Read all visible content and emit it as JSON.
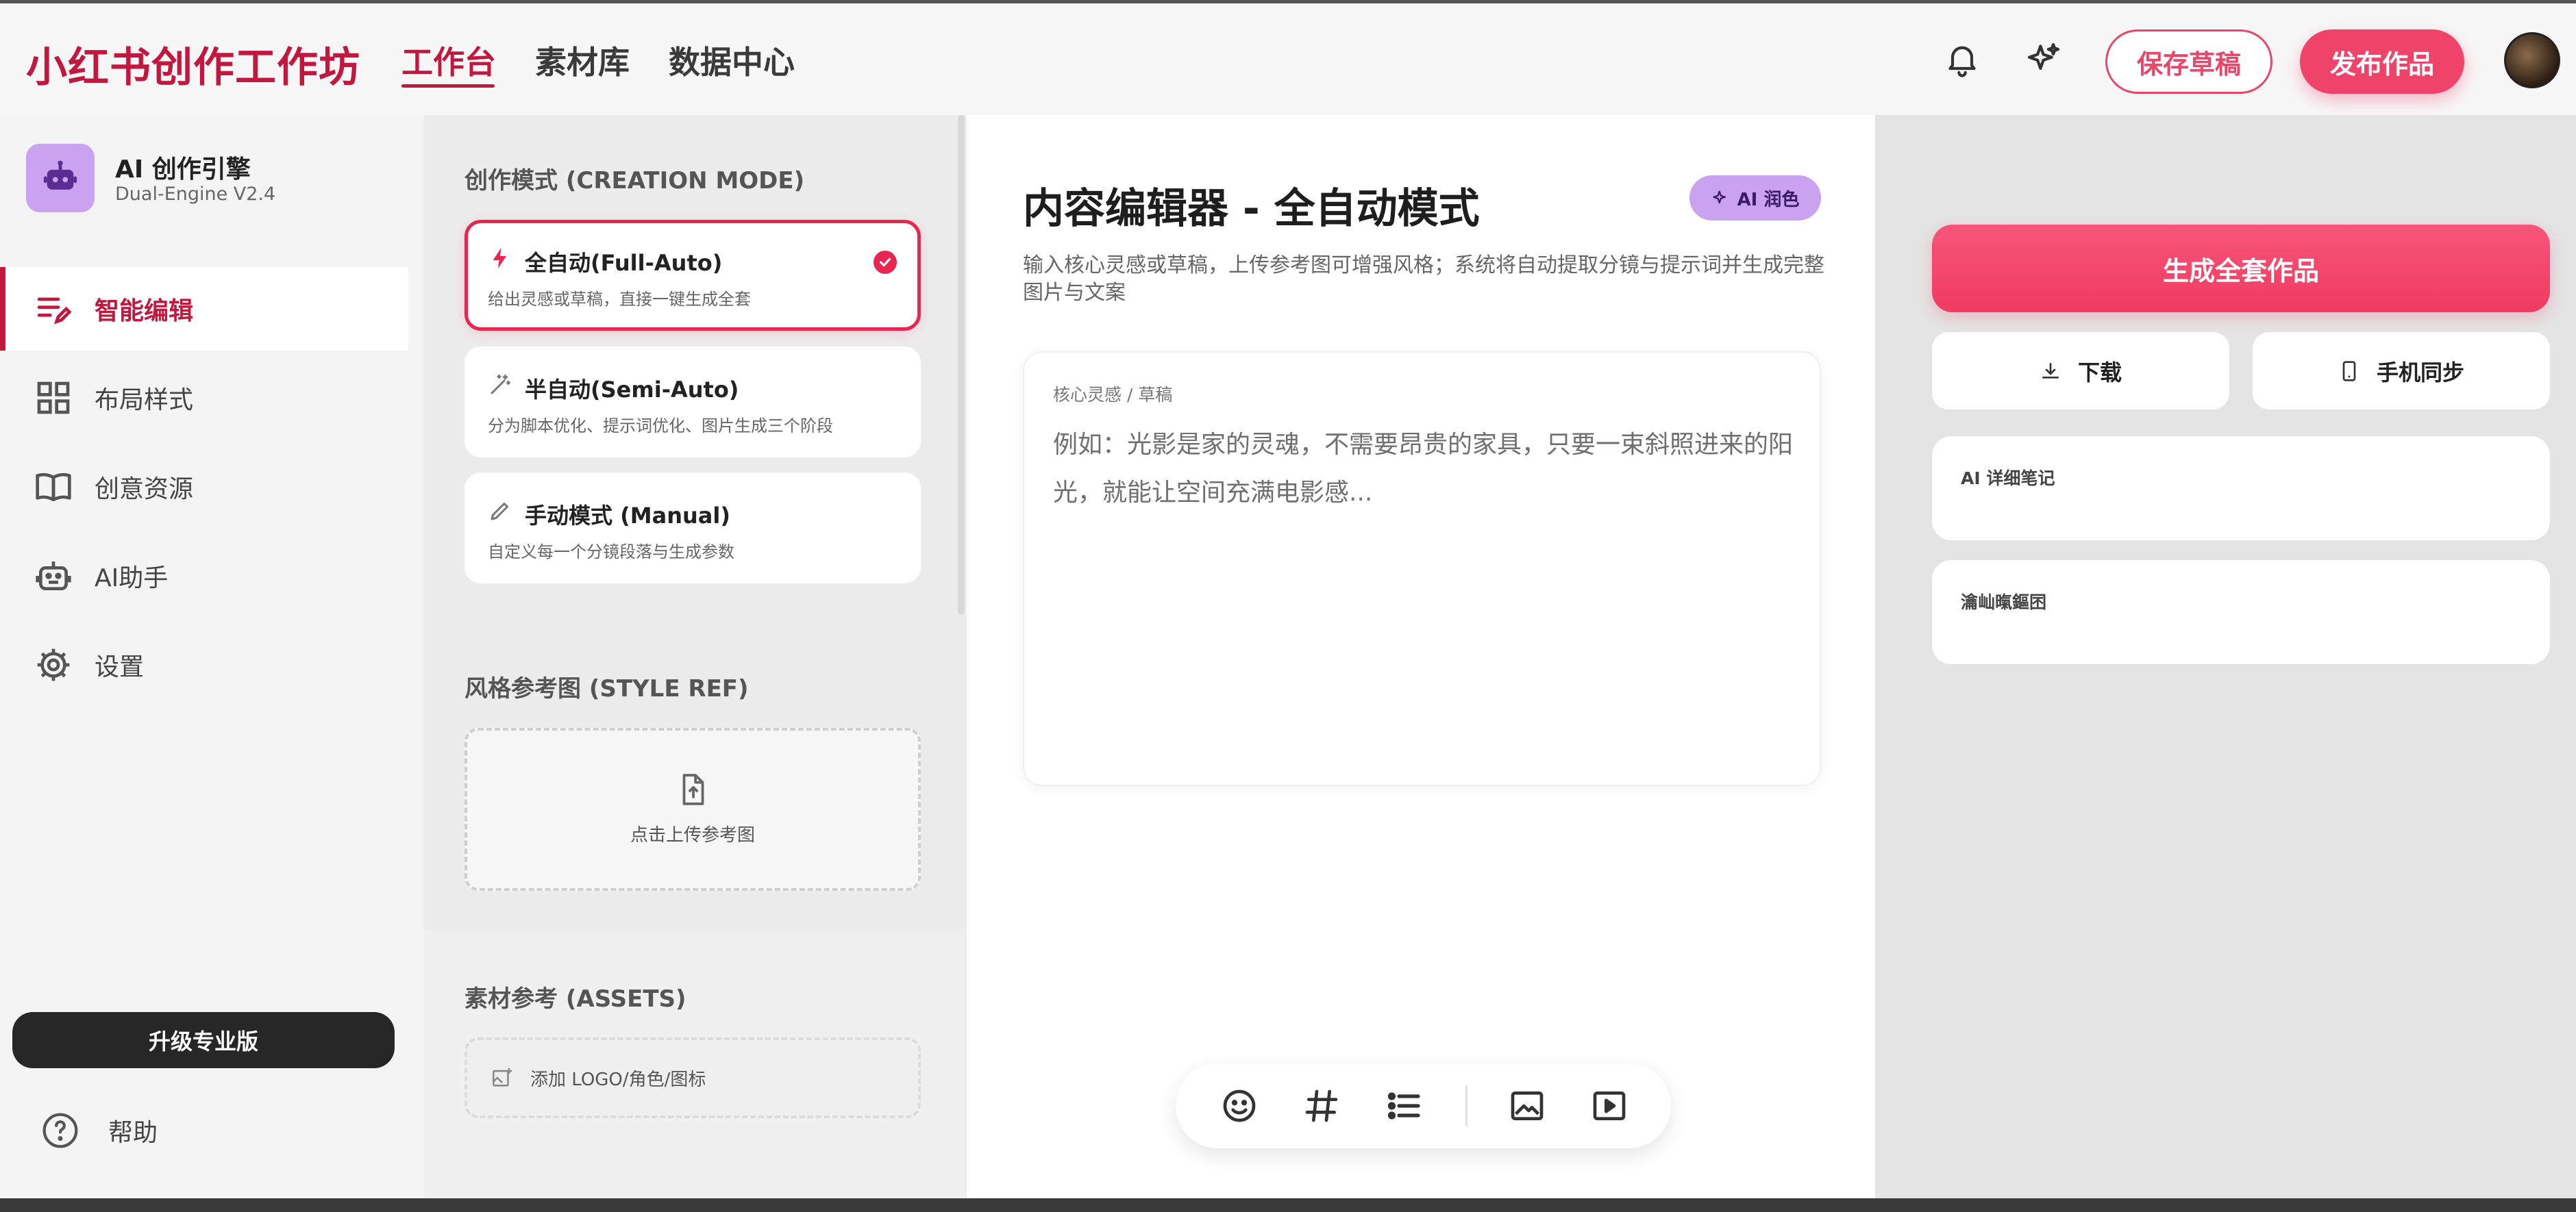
{
  "header": {
    "brand": "小红书创作工作坊",
    "tabs": [
      {
        "label": "工作台",
        "active": true
      },
      {
        "label": "素材库",
        "active": false
      },
      {
        "label": "数据中心",
        "active": false
      }
    ],
    "save_draft": "保存草稿",
    "publish": "发布作品"
  },
  "sidebar": {
    "engine_title": "AI 创作引擎",
    "engine_version": "Dual-Engine V2.4",
    "items": [
      {
        "label": "智能编辑",
        "icon": "edit-note-icon",
        "active": true
      },
      {
        "label": "布局样式",
        "icon": "grid-icon",
        "active": false
      },
      {
        "label": "创意资源",
        "icon": "book-icon",
        "active": false
      },
      {
        "label": "AI助手",
        "icon": "robot-icon",
        "active": false
      },
      {
        "label": "设置",
        "icon": "gear-icon",
        "active": false
      }
    ],
    "upgrade": "升级专业版",
    "help": "帮助"
  },
  "modes": {
    "title": "创作模式 (CREATION MODE)",
    "cards": [
      {
        "title": "全自动(Full-Auto)",
        "desc": "给出灵感或草稿，直接一键生成全套",
        "selected": true,
        "icon": "bolt-icon"
      },
      {
        "title": "半自动(Semi-Auto)",
        "desc": "分为脚本优化、提示词优化、图片生成三个阶段",
        "selected": false,
        "icon": "magic-wand-icon"
      },
      {
        "title": "手动模式 (Manual)",
        "desc": "自定义每一个分镜段落与生成参数",
        "selected": false,
        "icon": "pencil-icon"
      }
    ],
    "style_ref_title": "风格参考图 (STYLE REF)",
    "upload_label": "点击上传参考图",
    "assets_title": "素材参考 (ASSETS)",
    "assets_label": "添加 LOGO/角色/图标"
  },
  "editor": {
    "title": "内容编辑器 - 全自动模式",
    "ai_polish": "AI 润色",
    "description": "输入核心灵感或草稿，上传参考图可增强风格；系统将自动提取分镜与提示词并生成完整图片与文案",
    "input_label": "核心灵感 / 草稿",
    "input_placeholder": "例如：光影是家的灵魂，不需要昂贵的家具，只要一束斜照进来的阳光，就能让空间充满电影感..."
  },
  "toolbar": {
    "icons": [
      "emoji-icon",
      "hashtag-icon",
      "list-icon",
      "image-icon",
      "video-icon"
    ]
  },
  "right_panel": {
    "generate": "生成全套作品",
    "download": "下载",
    "phone_sync": "手机同步",
    "ai_notes": "AI 详细笔记",
    "second_card": "瀹屾暣鏂囨"
  },
  "colors": {
    "brand": "#c2173e",
    "accent": "#f0436a",
    "purple": "#c9a3f0"
  }
}
